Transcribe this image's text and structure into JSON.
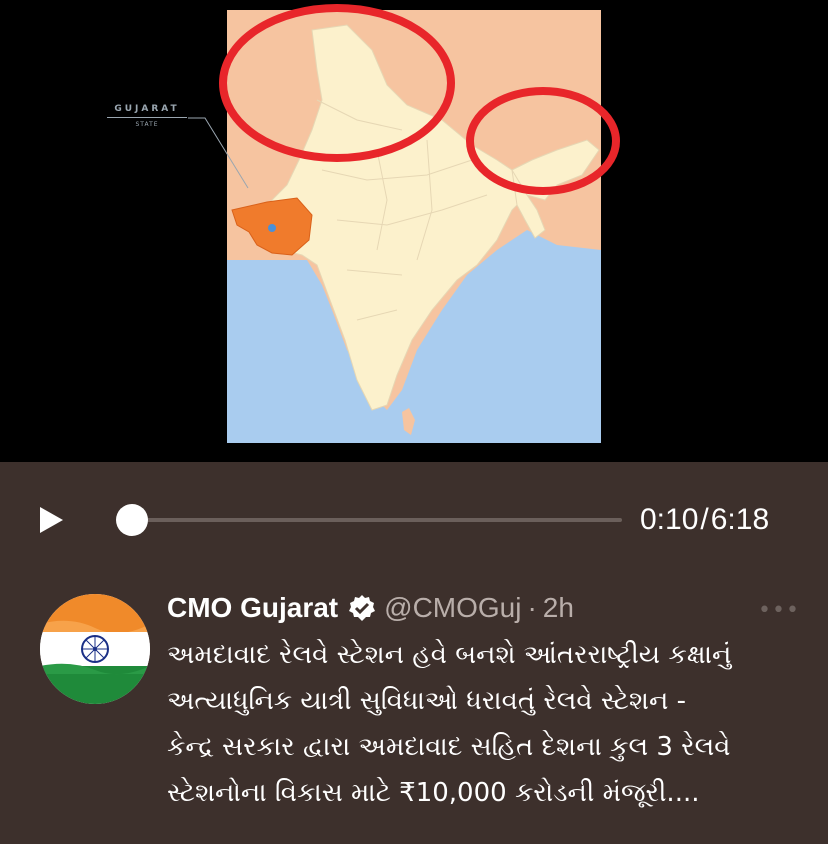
{
  "video": {
    "map": {
      "label_state_name": "GUJARAT",
      "label_state_sub": "STATE",
      "colors": {
        "sea": "#a9ccef",
        "land": "#fcf1cc",
        "neighbor": "#f6c4a0",
        "highlight_state": "#f07b2c",
        "circle": "#e8262a"
      }
    },
    "player": {
      "current_time": "0:10",
      "separator": "/",
      "duration": "6:18",
      "progress_fraction": 0.027,
      "play_icon": "play-icon"
    }
  },
  "post": {
    "author": "CMO Gujarat",
    "verified_icon": "verified-badge-icon",
    "handle": "@CMOGuj",
    "separator": "·",
    "age": "2h",
    "more_icon": "more-options-icon",
    "avatar_icon": "india-flag-avatar",
    "lines": [
      "અમદાવાદ રેલવે સ્ટેશન હવે બનશે આંતરરાષ્ટ્રીય કક્ષાનું",
      "અત્યાધુનિક યાત્રી સુવિધાઓ ધરાવતું રેલવે સ્ટેશન -",
      "કેન્દ્ર સરકાર દ્વારા અમદાવાદ સહિત દેશના કુલ 3 રેલવે",
      "સ્ટેશનોના વિકાસ માટે ₹10,000 કરોડની મંજૂરી...."
    ]
  }
}
